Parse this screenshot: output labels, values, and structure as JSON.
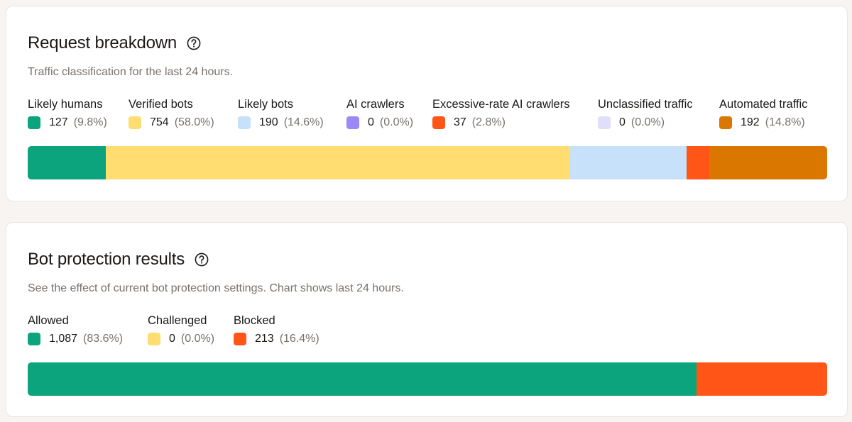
{
  "request_breakdown": {
    "title": "Request breakdown",
    "description": "Traffic classification for the last 24 hours.",
    "items": [
      {
        "label": "Likely humans",
        "count": "127",
        "pct": "(9.8%)",
        "value": 127,
        "color": "#0ca47c"
      },
      {
        "label": "Verified bots",
        "count": "754",
        "pct": "(58.0%)",
        "value": 754,
        "color": "#ffdd70"
      },
      {
        "label": "Likely bots",
        "count": "190",
        "pct": "(14.6%)",
        "value": 190,
        "color": "#c8e1fb"
      },
      {
        "label": "AI crawlers",
        "count": "0",
        "pct": "(0.0%)",
        "value": 0,
        "color": "#9d88f7"
      },
      {
        "label": "Excessive-rate AI crawlers",
        "count": "37",
        "pct": "(2.8%)",
        "value": 37,
        "color": "#ff5618"
      },
      {
        "label": "Unclassified traffic",
        "count": "0",
        "pct": "(0.0%)",
        "value": 0,
        "color": "#dfdefb"
      },
      {
        "label": "Automated traffic",
        "count": "192",
        "pct": "(14.8%)",
        "value": 192,
        "color": "#d97701"
      }
    ]
  },
  "bot_protection": {
    "title": "Bot protection results",
    "description": "See the effect of current bot protection settings. Chart shows last 24 hours.",
    "items": [
      {
        "label": "Allowed",
        "count": "1,087",
        "pct": "(83.6%)",
        "value": 1087,
        "color": "#0ca47c"
      },
      {
        "label": "Challenged",
        "count": "0",
        "pct": "(0.0%)",
        "value": 0,
        "color": "#ffdd70"
      },
      {
        "label": "Blocked",
        "count": "213",
        "pct": "(16.4%)",
        "value": 213,
        "color": "#ff5618"
      }
    ]
  },
  "icons": {
    "help": "help-circle-icon"
  }
}
